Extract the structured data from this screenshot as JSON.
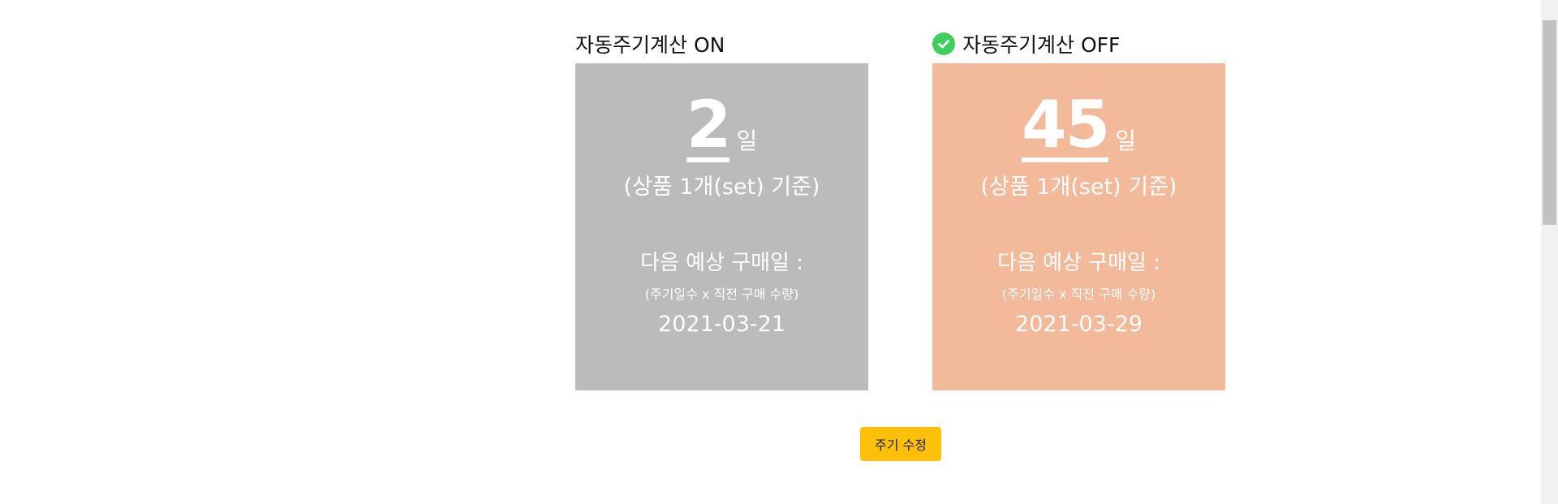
{
  "options": [
    {
      "title": "자동주기계산 ON",
      "selected": false,
      "card_color": "#bbbbbb",
      "period_value": "2",
      "period_unit": "일",
      "basis": "(상품 1개(set) 기준)",
      "next_label": "다음 예상 구매일 :",
      "next_formula": "(주기일수 x 직전 구매 수량)",
      "next_date": "2021-03-21"
    },
    {
      "title": "자동주기계산 OFF",
      "selected": true,
      "selected_icon": "check-circle-icon",
      "card_color": "#f2b99a",
      "period_value": "45",
      "period_unit": "일",
      "basis": "(상품 1개(set) 기준)",
      "next_label": "다음 예상 구매일 :",
      "next_formula": "(주기일수 x 직전 구매 수량)",
      "next_date": "2021-03-29"
    }
  ],
  "edit_button": {
    "label": "주기 수정",
    "color": "#fcc008"
  },
  "colors": {
    "check_icon": "#3ecf5e"
  }
}
